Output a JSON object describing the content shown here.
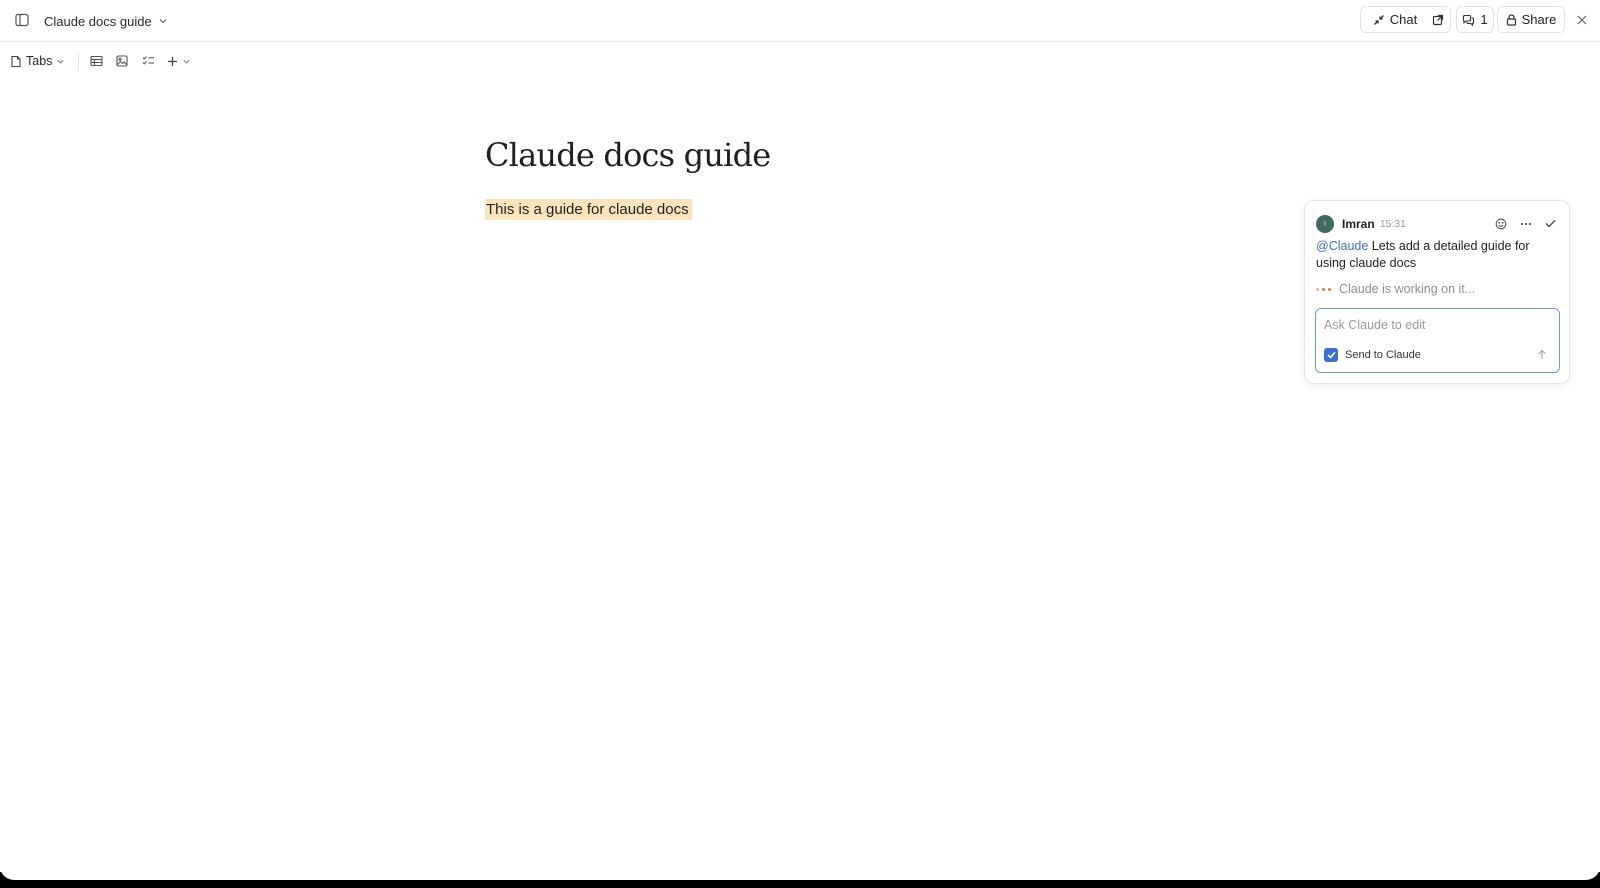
{
  "header": {
    "doc_title": "Claude docs guide",
    "chat_label": "Chat",
    "comment_count": "1",
    "share_label": "Share"
  },
  "toolbar": {
    "tabs_label": "Tabs"
  },
  "document": {
    "title": "Claude docs guide",
    "highlighted_text": "This is a guide for claude docs"
  },
  "comment": {
    "avatar_initial": "I",
    "author": "Imran",
    "time": "15:31",
    "mention": "@Claude",
    "message": " Lets add a detailed guide for using claude docs",
    "status": "Claude is working on it...",
    "input_placeholder": "Ask Claude to edit",
    "send_to_label": "Send to Claude",
    "send_to_checked": true
  },
  "colors": {
    "highlight": "#fbe3bd",
    "mention": "#3b6fb6",
    "accent": "#3b6fd0",
    "avatar": "#3f6b62"
  }
}
